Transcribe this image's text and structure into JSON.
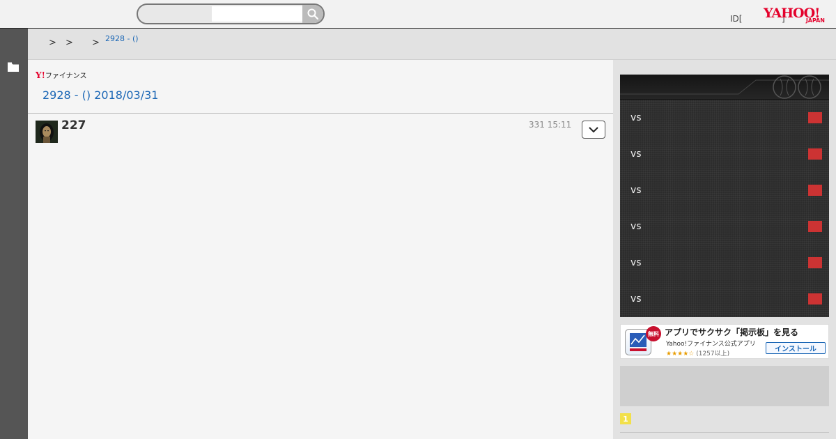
{
  "header": {
    "search": {
      "value": "",
      "placeholder": ""
    },
    "id_link": "ID[",
    "id_link_tail": "]",
    "logo": {
      "main": "YAHOO!",
      "sub": "JAPAN"
    }
  },
  "breadcrumb": {
    "separators": [
      ">",
      ">",
      ">"
    ],
    "current": "2928 - ()"
  },
  "main": {
    "brand": {
      "y": "Y!",
      "text": "ファイナンス"
    },
    "title": "2928 - () 2018/03/31",
    "post": {
      "count": "227",
      "time": "331 15:11"
    }
  },
  "scores": {
    "rows": [
      {
        "label": "vs"
      },
      {
        "label": "vs"
      },
      {
        "label": "vs"
      },
      {
        "label": "vs"
      },
      {
        "label": "vs"
      },
      {
        "label": "vs"
      }
    ],
    "flag_color": "#cc3333"
  },
  "app_banner": {
    "badge": "無料",
    "title": "アプリでサクサク「掲示板」を見る",
    "subtitle": "Yahoo!ファイナンス公式アプリ",
    "stars": "★★★★☆",
    "review_count": "(1257以上)",
    "install_label": "インストール"
  },
  "ranking": {
    "first": "1"
  },
  "colors": {
    "accent_link": "#1a66b5",
    "yahoo_red": "#e4002b",
    "sidebar": "#555555"
  }
}
